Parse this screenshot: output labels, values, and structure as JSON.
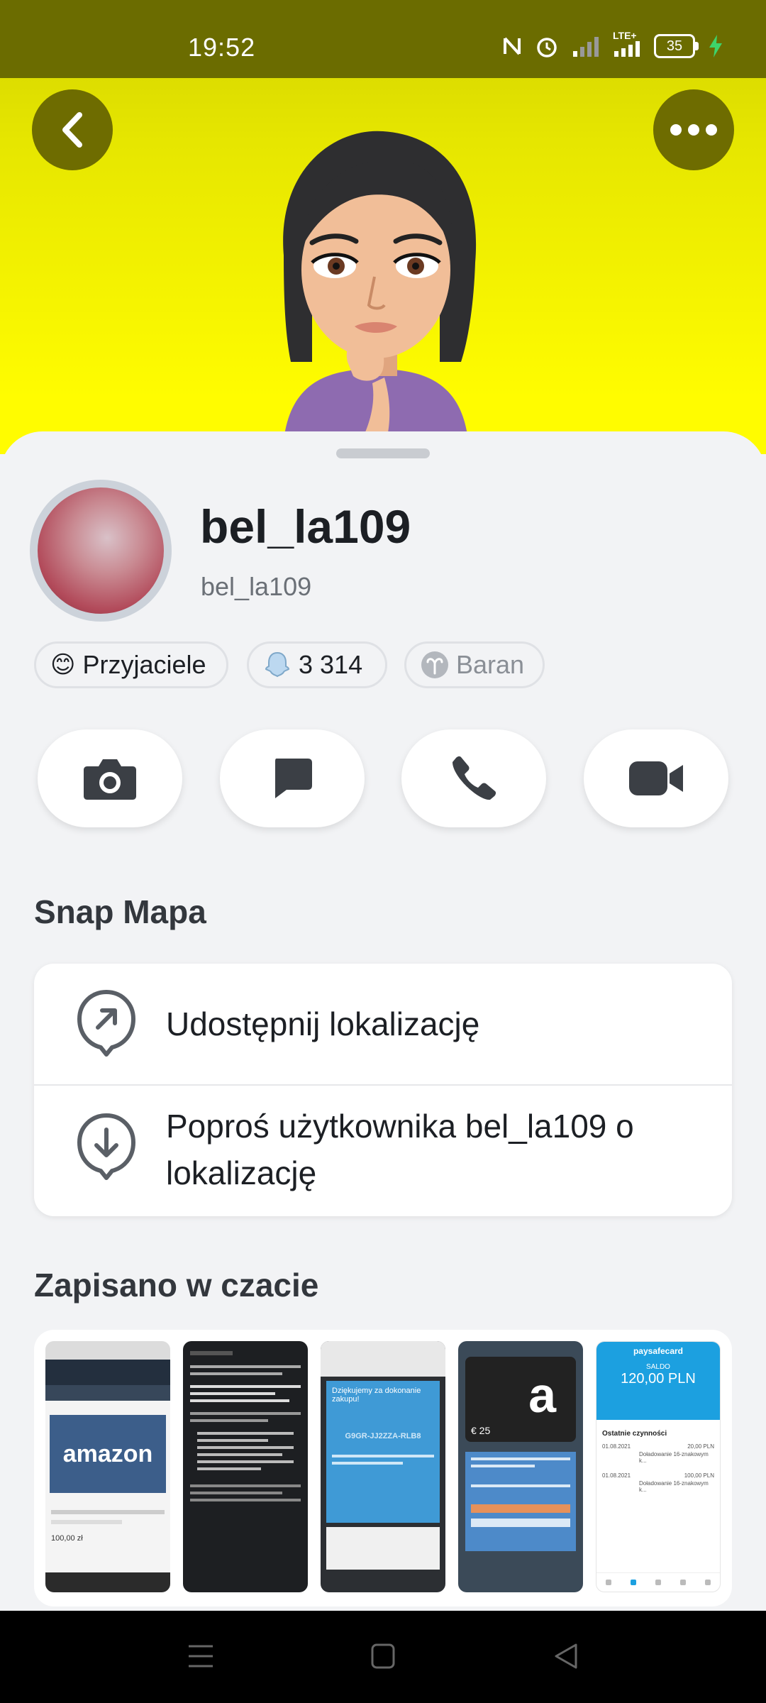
{
  "status_bar": {
    "time": "19:52",
    "network": "LTE+",
    "battery": "35"
  },
  "profile": {
    "display_name": "bel_la109",
    "username": "bel_la109"
  },
  "chips": [
    {
      "emoji": "😊",
      "label": "Przyjaciele"
    },
    {
      "label": "3 314"
    },
    {
      "label": "Baran"
    }
  ],
  "snap_map": {
    "title": "Snap Mapa",
    "share_location": "Udostępnij lokalizację",
    "request_location_line1": "Poproś użytkownika bel_la109 o",
    "request_location_line2": "lokalizację"
  },
  "saved": {
    "title": "Zapisano w czacie"
  },
  "thumbnails": {
    "amazon_logo": "amazon",
    "amazon_price": "100,00 zł",
    "email_subject": "Dziękujemy za dokonanie zakupu!",
    "gift_card_code": "G9GR-JJ2ZZA-RLB8",
    "card_value": "€ 25",
    "paysafe_brand": "paysafecard",
    "paysafe_saldo_label": "SALDO",
    "paysafe_amount": "120,00 PLN",
    "paysafe_recent": "Ostatnie czynności",
    "paysafe_rows": [
      {
        "date": "01.08.2021",
        "desc": "Doładowanie 16-znakowym k...",
        "amount": "20,00 PLN"
      },
      {
        "date": "01.08.2021",
        "desc": "Doładowanie 16-znakowym k...",
        "amount": "100,00 PLN"
      }
    ]
  },
  "colors": {
    "snap_yellow": "#fffc00",
    "status_olive": "#6b6c00",
    "sheet": "#f2f3f5"
  }
}
